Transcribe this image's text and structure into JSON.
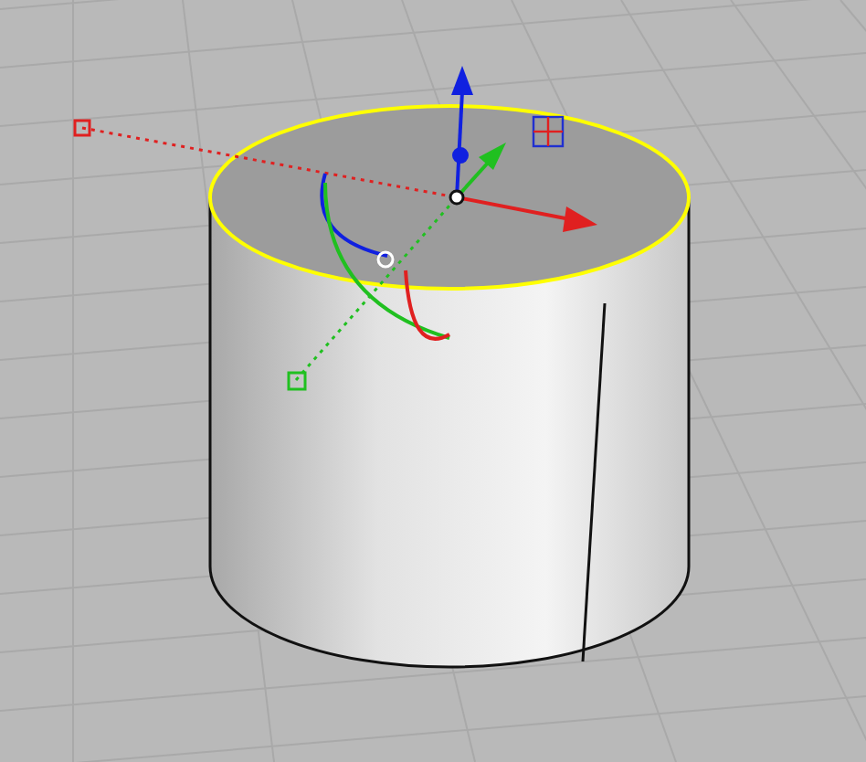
{
  "cylinder": {
    "selected": true
  }
}
